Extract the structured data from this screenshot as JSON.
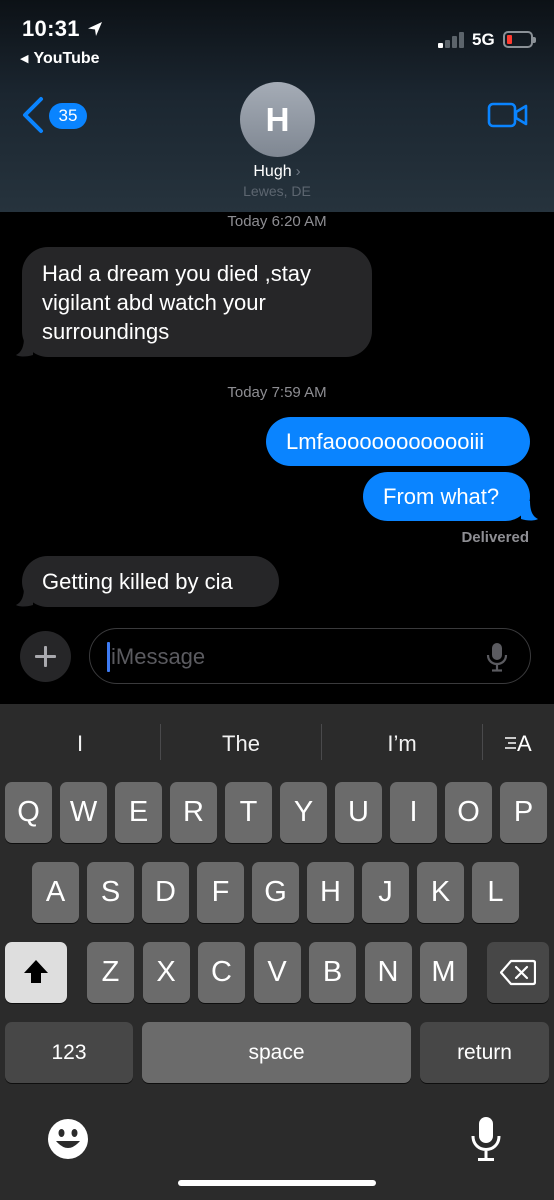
{
  "status_bar": {
    "time": "10:31",
    "back_app": "YouTube",
    "network": "5G",
    "icons": [
      "location-arrow-icon",
      "signal-bars-icon",
      "battery-low-icon"
    ]
  },
  "nav": {
    "unread_count": "35",
    "contact_initial": "H",
    "contact_name": "Hugh",
    "contact_location": "Lewes, DE",
    "icons": [
      "chevron-left-icon",
      "video-camera-icon"
    ]
  },
  "messages": {
    "ts1": "Today 6:20 AM",
    "msg1_line1": "Had a dream you died ,stay",
    "msg1_line2": "vigilant abd watch your",
    "msg1_line3": "surroundings",
    "ts2": "Today 7:59 AM",
    "msg2": "Lmfaoooooooooooiii",
    "msg3": "From what?",
    "delivered": "Delivered",
    "msg4": "Getting killed by cia"
  },
  "composer": {
    "placeholder": "iMessage",
    "value": "",
    "icons": [
      "plus-icon",
      "microphone-icon"
    ]
  },
  "keyboard": {
    "suggestions": [
      "I",
      "The",
      "I’m"
    ],
    "format_label": "A",
    "row1": [
      "Q",
      "W",
      "E",
      "R",
      "T",
      "Y",
      "U",
      "I",
      "O",
      "P"
    ],
    "row2": [
      "A",
      "S",
      "D",
      "F",
      "G",
      "H",
      "J",
      "K",
      "L"
    ],
    "row3": [
      "Z",
      "X",
      "C",
      "V",
      "B",
      "N",
      "M"
    ],
    "numbers_label": "123",
    "space_label": "space",
    "return_label": "return",
    "icons": [
      "shift-icon",
      "backspace-icon",
      "emoji-icon",
      "dictation-mic-icon"
    ]
  },
  "colors": {
    "accent_blue": "#0a84ff",
    "incoming_bubble": "#262628",
    "battery_low": "#ff3b30"
  }
}
